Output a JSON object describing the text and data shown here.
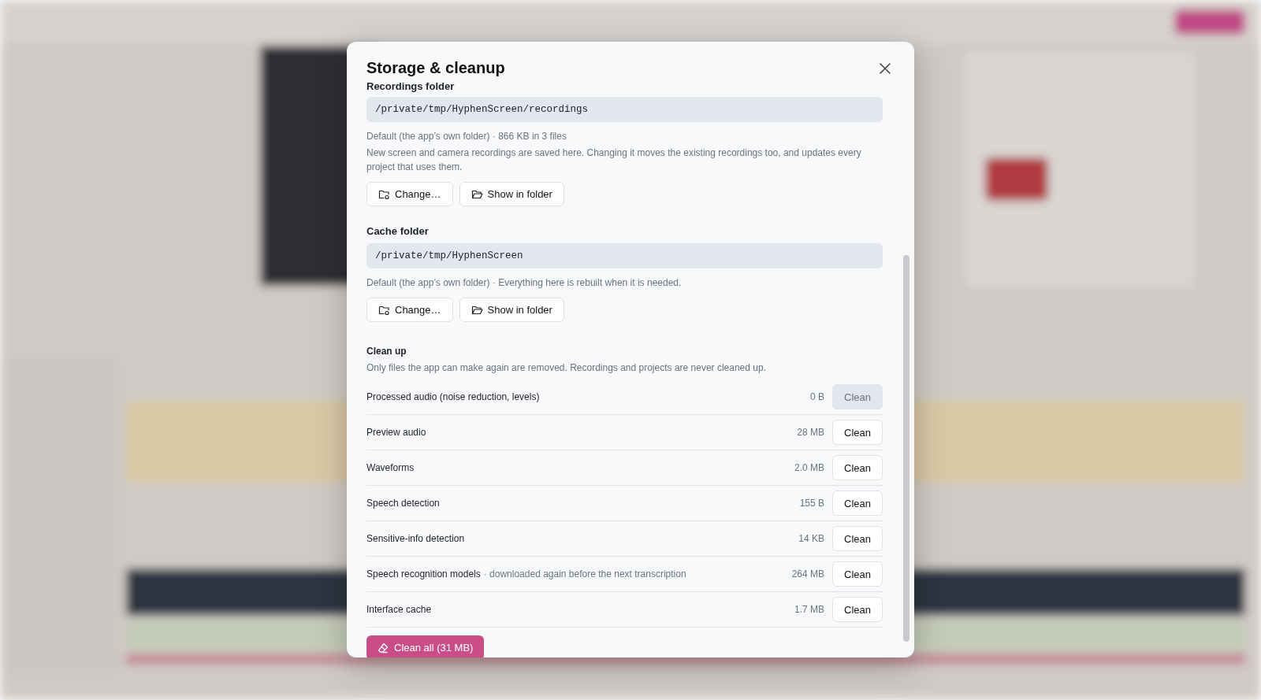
{
  "dialog": {
    "title": "Storage & cleanup",
    "recordings": {
      "heading": "Recordings folder",
      "path": "/private/tmp/HyphenScreen/recordings",
      "info": "Default (the app’s own folder) · 866 KB in 3 files",
      "description": "New screen and camera recordings are saved here. Changing it moves the existing recordings too, and updates every project that uses them.",
      "buttons": [
        {
          "kind": "change",
          "label": "Change…"
        },
        {
          "kind": "show",
          "label": "Show in folder"
        }
      ]
    },
    "cache": {
      "heading": "Cache folder",
      "path": "/private/tmp/HyphenScreen",
      "info": "Default (the app’s own folder) · Everything here is rebuilt when it is needed.",
      "buttons": [
        {
          "kind": "change",
          "label": "Change…"
        },
        {
          "kind": "show",
          "label": "Show in folder"
        }
      ]
    },
    "cleanup": {
      "heading": "Clean up",
      "description": "Only files the app can make again are removed. Recordings and projects are never cleaned up.",
      "rows": [
        {
          "name": "Processed audio (noise reduction, levels)",
          "size": "0 B",
          "button": "Clean",
          "disabled": true
        },
        {
          "name": "Preview audio",
          "size": "28 MB",
          "button": "Clean",
          "disabled": false
        },
        {
          "name": "Waveforms",
          "size": "2.0 MB",
          "button": "Clean",
          "disabled": false
        },
        {
          "name": "Speech detection",
          "size": "155 B",
          "button": "Clean",
          "disabled": false
        },
        {
          "name": "Sensitive-info detection",
          "size": "14 KB",
          "button": "Clean",
          "disabled": false
        },
        {
          "name": "Speech recognition models",
          "note": "· downloaded again before the next transcription",
          "size": "264 MB",
          "button": "Clean",
          "disabled": false
        },
        {
          "name": "Interface cache",
          "size": "1.7 MB",
          "button": "Clean",
          "disabled": false
        }
      ],
      "clean_all": "Clean all (31 MB)"
    }
  }
}
